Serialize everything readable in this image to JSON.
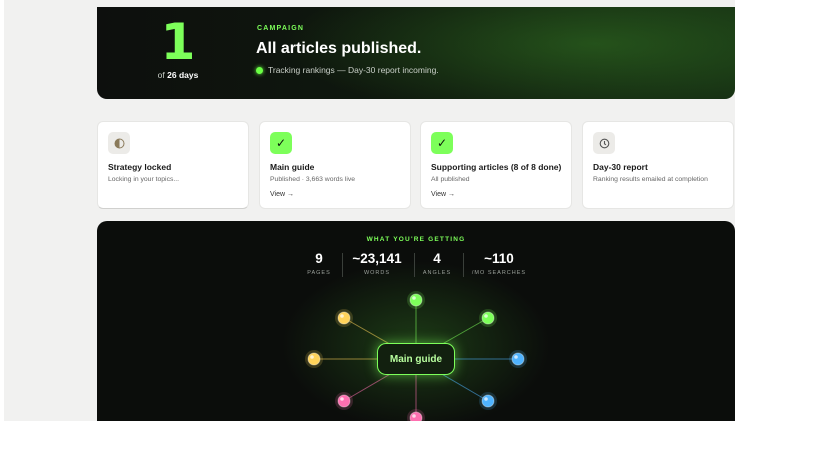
{
  "hero": {
    "big_number": "1",
    "of_prefix": "of",
    "of_days": "26 days",
    "tag": "CAMPAIGN",
    "title": "All articles published.",
    "status": "Tracking rankings — Day-30 report incoming."
  },
  "steps": [
    {
      "icon": "half-circle-icon",
      "title": "Strategy locked",
      "subtitle": "Locking in your topics...",
      "link": ""
    },
    {
      "icon": "check-icon",
      "title": "Main guide",
      "subtitle": "Published · 3,663 words live",
      "link": "View →"
    },
    {
      "icon": "check-icon",
      "title": "Supporting articles (8 of 8 done)",
      "subtitle": "All published",
      "link": "View →"
    },
    {
      "icon": "clock-icon",
      "title": "Day-30 report",
      "subtitle": "Ranking results emailed at completion",
      "link": ""
    }
  ],
  "deliverables": {
    "tag": "WHAT YOU'RE GETTING",
    "stats": [
      {
        "value": "9",
        "label": "PAGES"
      },
      {
        "value": "~23,141",
        "label": "WORDS"
      },
      {
        "value": "4",
        "label": "ANGLES"
      },
      {
        "value": "~110",
        "label": "/MO SEARCHES"
      }
    ],
    "hub_label": "Main guide",
    "node_colors": [
      "#7dff5a",
      "#7dff5a",
      "#4fb3ff",
      "#4fb3ff",
      "#ff6fb0",
      "#ff6fb0",
      "#ffd35a",
      "#ffd35a"
    ]
  },
  "colors": {
    "accent": "#7dff5a",
    "blue": "#4fb3ff",
    "pink": "#ff6fb0",
    "yellow": "#ffd35a"
  }
}
